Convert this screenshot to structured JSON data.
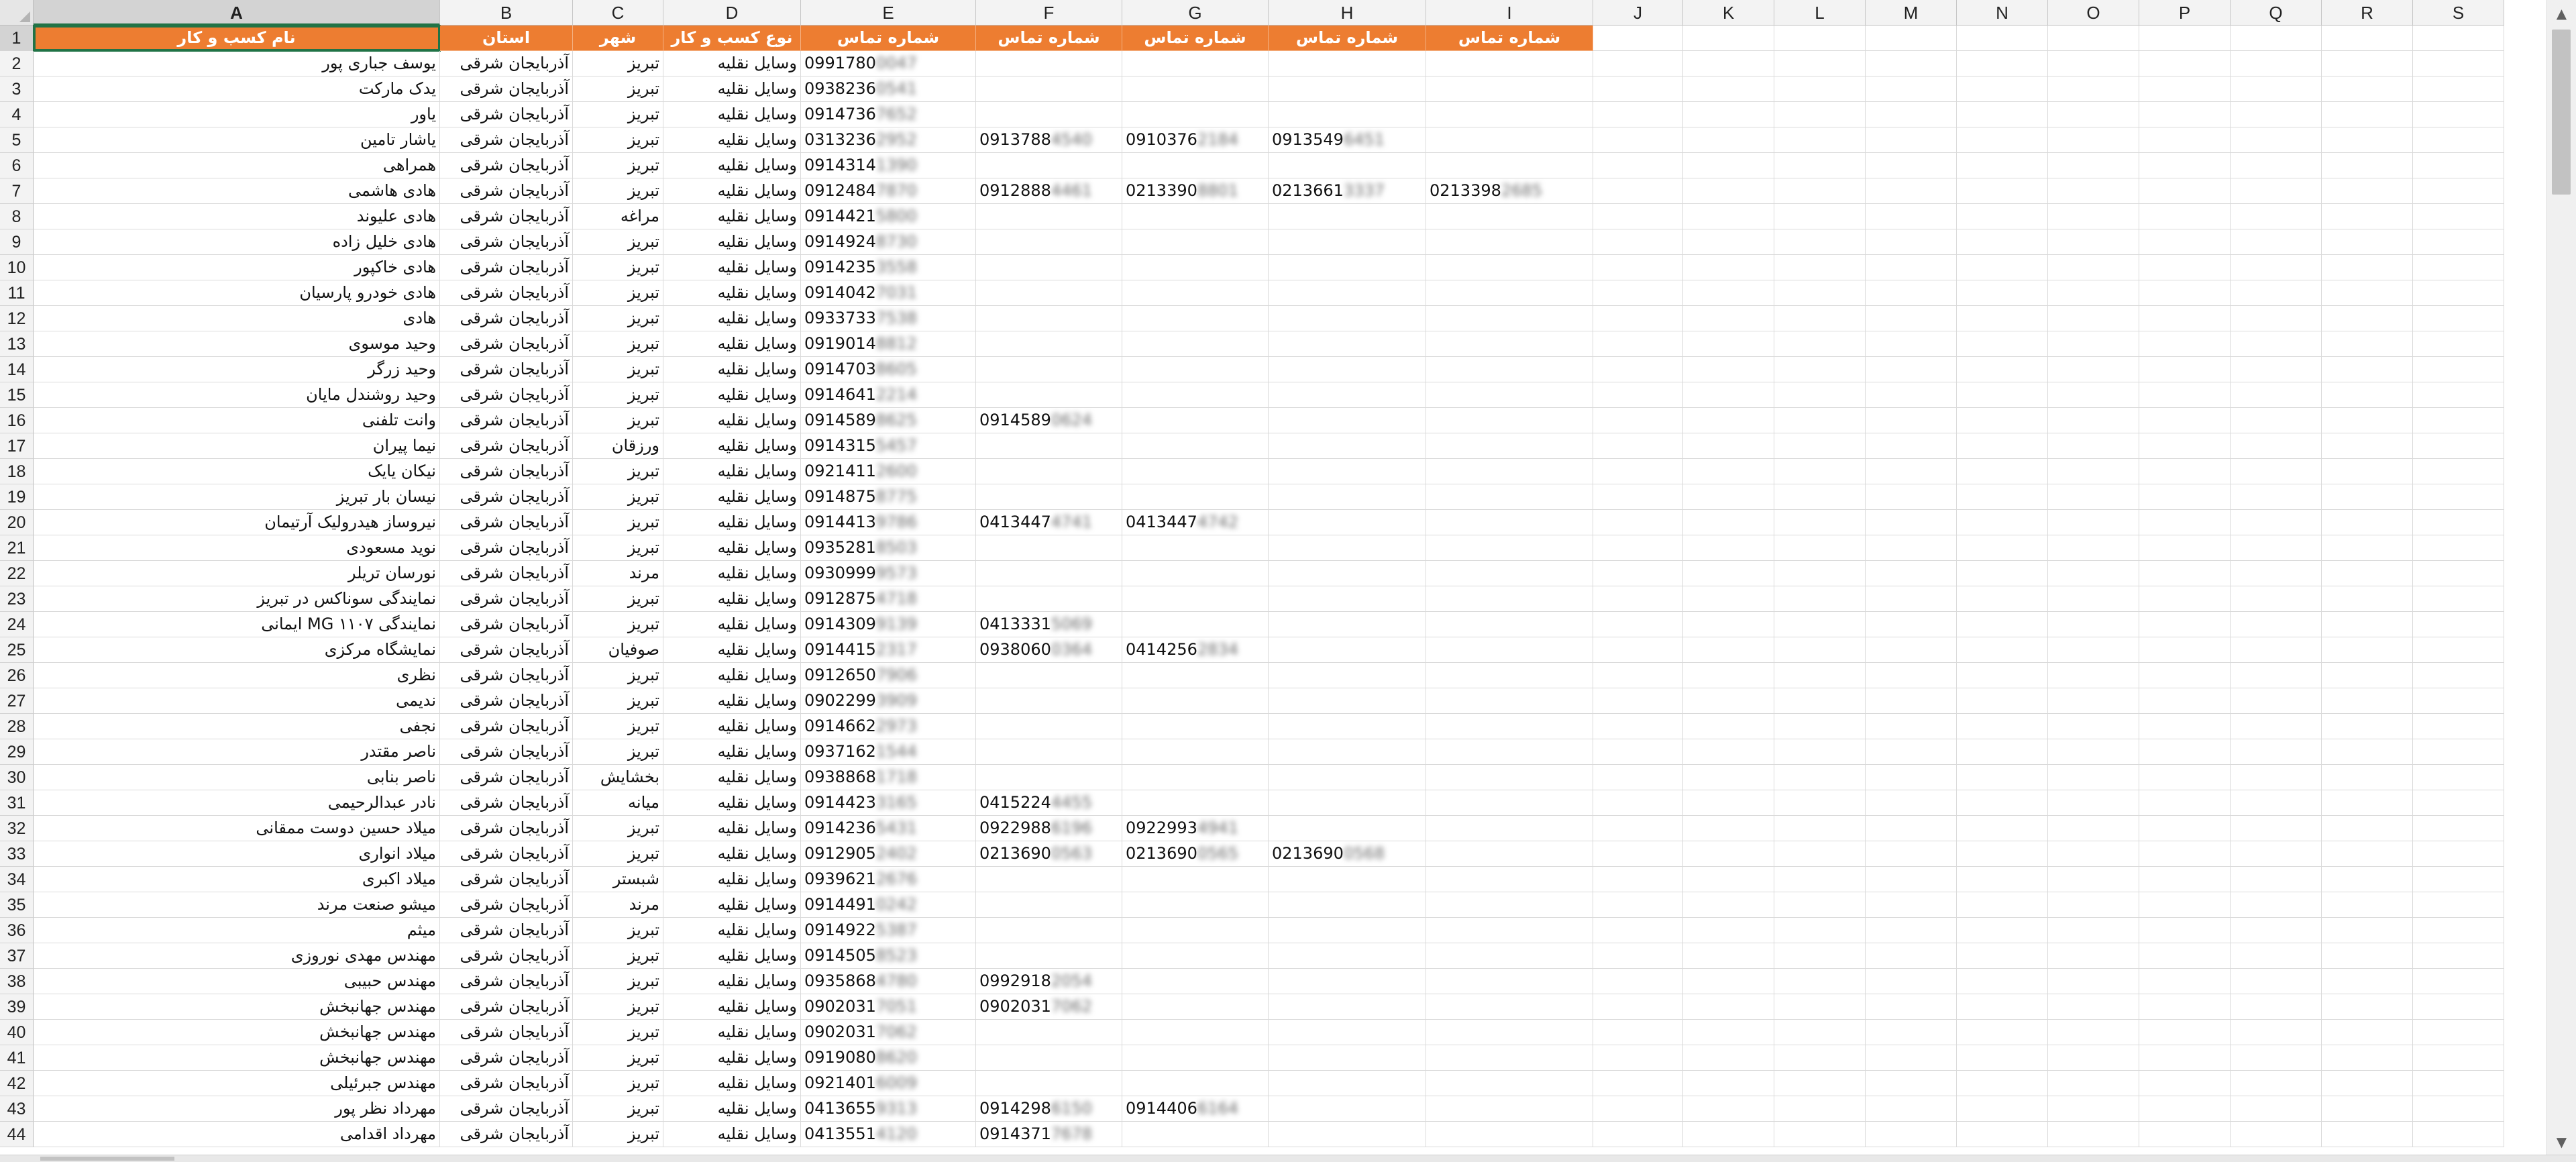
{
  "column_letters": [
    "A",
    "B",
    "C",
    "D",
    "E",
    "F",
    "G",
    "H",
    "I",
    "J",
    "K",
    "L",
    "M",
    "N",
    "O",
    "P",
    "Q",
    "R",
    "S"
  ],
  "selected_column": "A",
  "header_row_number": "1",
  "headers": [
    "نام کسب و کار",
    "استان",
    "شهر",
    "نوع کسب و کار",
    "شماره تماس",
    "شماره تماس",
    "شماره تماس",
    "شماره تماس",
    "شماره تماس"
  ],
  "rows": [
    {
      "n": "2",
      "name": "یوسف جباری پور",
      "province": "آذربایجان شرقی",
      "city": "تبریز",
      "type": "وسایل نقلیه",
      "phones": [
        [
          "0991780",
          "0047"
        ]
      ]
    },
    {
      "n": "3",
      "name": "یدک مارکت",
      "province": "آذربایجان شرقی",
      "city": "تبریز",
      "type": "وسایل نقلیه",
      "phones": [
        [
          "0938236",
          "0541"
        ]
      ]
    },
    {
      "n": "4",
      "name": "یاور",
      "province": "آذربایجان شرقی",
      "city": "تبریز",
      "type": "وسایل نقلیه",
      "phones": [
        [
          "0914736",
          "7652"
        ]
      ]
    },
    {
      "n": "5",
      "name": "یاشار تامین",
      "province": "آذربایجان شرقی",
      "city": "تبریز",
      "type": "وسایل نقلیه",
      "phones": [
        [
          "0313236",
          "2952"
        ],
        [
          "0913788",
          "4540"
        ],
        [
          "0910376",
          "2184"
        ],
        [
          "0913549",
          "6451"
        ]
      ]
    },
    {
      "n": "6",
      "name": "همراهی",
      "province": "آذربایجان شرقی",
      "city": "تبریز",
      "type": "وسایل نقلیه",
      "phones": [
        [
          "0914314",
          "1390"
        ]
      ]
    },
    {
      "n": "7",
      "name": "هادی هاشمی",
      "province": "آذربایجان شرقی",
      "city": "تبریز",
      "type": "وسایل نقلیه",
      "phones": [
        [
          "0912484",
          "7870"
        ],
        [
          "0912888",
          "4461"
        ],
        [
          "0213390",
          "8801"
        ],
        [
          "0213661",
          "3337"
        ],
        [
          "0213398",
          "2685"
        ]
      ]
    },
    {
      "n": "8",
      "name": "هادی علیوند",
      "province": "آذربایجان شرقی",
      "city": "مراغه",
      "type": "وسایل نقلیه",
      "phones": [
        [
          "0914421",
          "5800"
        ]
      ]
    },
    {
      "n": "9",
      "name": "هادی خلیل زاده",
      "province": "آذربایجان شرقی",
      "city": "تبریز",
      "type": "وسایل نقلیه",
      "phones": [
        [
          "0914924",
          "8730"
        ]
      ]
    },
    {
      "n": "10",
      "name": "هادی خاکپور",
      "province": "آذربایجان شرقی",
      "city": "تبریز",
      "type": "وسایل نقلیه",
      "phones": [
        [
          "0914235",
          "3558"
        ]
      ]
    },
    {
      "n": "11",
      "name": "هادی  خودرو پارسیان",
      "province": "آذربایجان شرقی",
      "city": "تبریز",
      "type": "وسایل نقلیه",
      "phones": [
        [
          "0914042",
          "7031"
        ]
      ]
    },
    {
      "n": "12",
      "name": "هادی",
      "province": "آذربایجان شرقی",
      "city": "تبریز",
      "type": "وسایل نقلیه",
      "phones": [
        [
          "0933733",
          "7538"
        ]
      ]
    },
    {
      "n": "13",
      "name": "وحید موسوی",
      "province": "آذربایجان شرقی",
      "city": "تبریز",
      "type": "وسایل نقلیه",
      "phones": [
        [
          "0919014",
          "8812"
        ]
      ]
    },
    {
      "n": "14",
      "name": "وحید زرگر",
      "province": "آذربایجان شرقی",
      "city": "تبریز",
      "type": "وسایل نقلیه",
      "phones": [
        [
          "0914703",
          "8605"
        ]
      ]
    },
    {
      "n": "15",
      "name": "وحید روشندل مایان",
      "province": "آذربایجان شرقی",
      "city": "تبریز",
      "type": "وسایل نقلیه",
      "phones": [
        [
          "0914641",
          "2214"
        ]
      ]
    },
    {
      "n": "16",
      "name": "وانت تلفنی",
      "province": "آذربایجان شرقی",
      "city": "تبریز",
      "type": "وسایل نقلیه",
      "phones": [
        [
          "0914589",
          "8625"
        ],
        [
          "0914589",
          "0624"
        ]
      ]
    },
    {
      "n": "17",
      "name": "نیما پیران",
      "province": "آذربایجان شرقی",
      "city": "ورزقان",
      "type": "وسایل نقلیه",
      "phones": [
        [
          "0914315",
          "5457"
        ]
      ]
    },
    {
      "n": "18",
      "name": "نیکان یایک",
      "province": "آذربایجان شرقی",
      "city": "تبریز",
      "type": "وسایل نقلیه",
      "phones": [
        [
          "0921411",
          "2600"
        ]
      ]
    },
    {
      "n": "19",
      "name": "نیسان بار تبریز",
      "province": "آذربایجان شرقی",
      "city": "تبریز",
      "type": "وسایل نقلیه",
      "phones": [
        [
          "0914875",
          "8775"
        ]
      ]
    },
    {
      "n": "20",
      "name": "نیروساز هیدرولیک آرتیمان",
      "province": "آذربایجان شرقی",
      "city": "تبریز",
      "type": "وسایل نقلیه",
      "phones": [
        [
          "0914413",
          "9786"
        ],
        [
          "0413447",
          "4741"
        ],
        [
          "0413447",
          "4742"
        ]
      ]
    },
    {
      "n": "21",
      "name": "نوید مسعودی",
      "province": "آذربایجان شرقی",
      "city": "تبریز",
      "type": "وسایل نقلیه",
      "phones": [
        [
          "0935281",
          "8503"
        ]
      ]
    },
    {
      "n": "22",
      "name": "نورسان تریلر",
      "province": "آذربایجان شرقی",
      "city": "مرند",
      "type": "وسایل نقلیه",
      "phones": [
        [
          "0930999",
          "9573"
        ]
      ]
    },
    {
      "n": "23",
      "name": "نمایندگی سوناکس در تبریز",
      "province": "آذربایجان شرقی",
      "city": "تبریز",
      "type": "وسایل نقلیه",
      "phones": [
        [
          "0912875",
          "4718"
        ]
      ]
    },
    {
      "n": "24",
      "name": "نمایندگی MG ۱۱۰۷ ایمانی",
      "province": "آذربایجان شرقی",
      "city": "تبریز",
      "type": "وسایل نقلیه",
      "phones": [
        [
          "0914309",
          "9139"
        ],
        [
          "0413331",
          "5069"
        ]
      ]
    },
    {
      "n": "25",
      "name": "نمایشگاه مرکزی",
      "province": "آذربایجان شرقی",
      "city": "صوفیان",
      "type": "وسایل نقلیه",
      "phones": [
        [
          "0914415",
          "2317"
        ],
        [
          "0938060",
          "0364"
        ],
        [
          "0414256",
          "2834"
        ]
      ]
    },
    {
      "n": "26",
      "name": "نظری",
      "province": "آذربایجان شرقی",
      "city": "تبریز",
      "type": "وسایل نقلیه",
      "phones": [
        [
          "0912650",
          "7906"
        ]
      ]
    },
    {
      "n": "27",
      "name": "ندیمی",
      "province": "آذربایجان شرقی",
      "city": "تبریز",
      "type": "وسایل نقلیه",
      "phones": [
        [
          "0902299",
          "3909"
        ]
      ]
    },
    {
      "n": "28",
      "name": "نجفی",
      "province": "آذربایجان شرقی",
      "city": "تبریز",
      "type": "وسایل نقلیه",
      "phones": [
        [
          "0914662",
          "2973"
        ]
      ]
    },
    {
      "n": "29",
      "name": "ناصر مقتدر",
      "province": "آذربایجان شرقی",
      "city": "تبریز",
      "type": "وسایل نقلیه",
      "phones": [
        [
          "0937162",
          "1544"
        ]
      ]
    },
    {
      "n": "30",
      "name": "ناصر بنابی",
      "province": "آذربایجان شرقی",
      "city": "بخشایش",
      "type": "وسایل نقلیه",
      "phones": [
        [
          "0938868",
          "1718"
        ]
      ]
    },
    {
      "n": "31",
      "name": "نادر عبدالرحیمی",
      "province": "آذربایجان شرقی",
      "city": "میانه",
      "type": "وسایل نقلیه",
      "phones": [
        [
          "0914423",
          "3165"
        ],
        [
          "0415224",
          "4455"
        ]
      ]
    },
    {
      "n": "32",
      "name": "میلاد حسین دوست ممقانی",
      "province": "آذربایجان شرقی",
      "city": "تبریز",
      "type": "وسایل نقلیه",
      "phones": [
        [
          "0914236",
          "5431"
        ],
        [
          "0922988",
          "6196"
        ],
        [
          "0922993",
          "4941"
        ]
      ]
    },
    {
      "n": "33",
      "name": "میلاد انواری",
      "province": "آذربایجان شرقی",
      "city": "تبریز",
      "type": "وسایل نقلیه",
      "phones": [
        [
          "0912905",
          "2402"
        ],
        [
          "0213690",
          "0563"
        ],
        [
          "0213690",
          "0565"
        ],
        [
          "0213690",
          "0568"
        ]
      ]
    },
    {
      "n": "34",
      "name": "میلاد اکبری",
      "province": "آذربایجان شرقی",
      "city": "شبستر",
      "type": "وسایل نقلیه",
      "phones": [
        [
          "0939621",
          "2676"
        ]
      ]
    },
    {
      "n": "35",
      "name": "میشو صنعت مرند",
      "province": "آذربایجان شرقی",
      "city": "مرند",
      "type": "وسایل نقلیه",
      "phones": [
        [
          "0914491",
          "0242"
        ]
      ]
    },
    {
      "n": "36",
      "name": "میثم",
      "province": "آذربایجان شرقی",
      "city": "تبریز",
      "type": "وسایل نقلیه",
      "phones": [
        [
          "0914922",
          "5387"
        ]
      ]
    },
    {
      "n": "37",
      "name": "مهندس مهدی نوروزی",
      "province": "آذربایجان شرقی",
      "city": "تبریز",
      "type": "وسایل نقلیه",
      "phones": [
        [
          "0914505",
          "8523"
        ]
      ]
    },
    {
      "n": "38",
      "name": "مهندس حبیبی",
      "province": "آذربایجان شرقی",
      "city": "تبریز",
      "type": "وسایل نقلیه",
      "phones": [
        [
          "0935868",
          "4780"
        ],
        [
          "0992918",
          "2054"
        ]
      ]
    },
    {
      "n": "39",
      "name": "مهندس جهانبخش",
      "province": "آذربایجان شرقی",
      "city": "تبریز",
      "type": "وسایل نقلیه",
      "phones": [
        [
          "0902031",
          "7051"
        ],
        [
          "0902031",
          "7062"
        ]
      ]
    },
    {
      "n": "40",
      "name": "مهندس جهانبخش",
      "province": "آذربایجان شرقی",
      "city": "تبریز",
      "type": "وسایل نقلیه",
      "phones": [
        [
          "0902031",
          "7062"
        ]
      ]
    },
    {
      "n": "41",
      "name": "مهندس جهانبخش",
      "province": "آذربایجان شرقی",
      "city": "تبریز",
      "type": "وسایل نقلیه",
      "phones": [
        [
          "0919080",
          "8620"
        ]
      ]
    },
    {
      "n": "42",
      "name": "مهندس جبرئیلی",
      "province": "آذربایجان شرقی",
      "city": "تبریز",
      "type": "وسایل نقلیه",
      "phones": [
        [
          "0921401",
          "6009"
        ]
      ]
    },
    {
      "n": "43",
      "name": "مهرداد نظر پور",
      "province": "آذربایجان شرقی",
      "city": "تبریز",
      "type": "وسایل نقلیه",
      "phones": [
        [
          "0413655",
          "9313"
        ],
        [
          "0914298",
          "6150"
        ],
        [
          "0914406",
          "6164"
        ]
      ]
    },
    {
      "n": "44",
      "name": "مهرداد اقدامی",
      "province": "آذربایجان شرقی",
      "city": "تبریز",
      "type": "وسایل نقلیه",
      "phones": [
        [
          "0413551",
          "4120"
        ],
        [
          "0914371",
          "7678"
        ]
      ]
    }
  ],
  "scrollbar": {
    "up_icon": "scroll-up-arrow",
    "down_icon": "scroll-down-arrow"
  },
  "colors": {
    "header_fill": "#ed7d31",
    "header_text": "#ffffff",
    "selection": "#217346",
    "grid": "#dadada"
  }
}
